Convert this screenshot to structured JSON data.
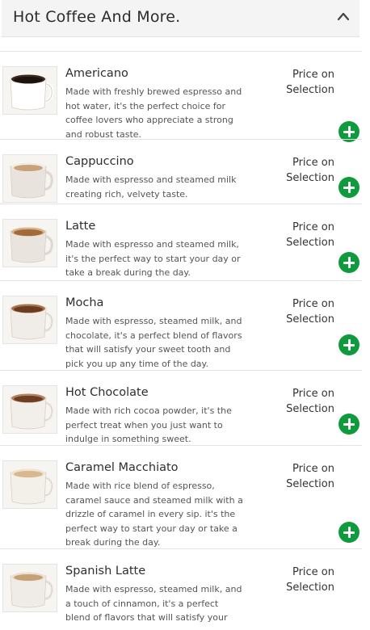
{
  "section": {
    "title": "Hot Coffee And More.",
    "collapse_icon": "chevron-up-icon"
  },
  "items": [
    {
      "name": "Americano",
      "lines": [
        "Made with freshly brewed espresso and",
        "hot water, it's the perfect choice for",
        "coffee lovers who appreciate a strong",
        "and robust taste."
      ],
      "price_line1": "Price on",
      "price_line2": "Selection",
      "image": "americano-image",
      "cup": "#1d120c",
      "rim": "#3a2a20",
      "mug": "#ffffff"
    },
    {
      "name": "Cappuccino",
      "lines": [
        "Made with espresso and steamed milk",
        "creating rich, velvety taste."
      ],
      "price_line1": "Price on",
      "price_line2": "Selection",
      "image": "cappuccino-image",
      "cup": "#c9a27a",
      "rim": "#f1ebe3",
      "mug": "#e8e3dc"
    },
    {
      "name": "Latte",
      "lines": [
        "Made with espresso and steamed milk,",
        "it's the perfect way to start your day or",
        "take a break during the day."
      ],
      "price_line1": "Price on",
      "price_line2": "Selection",
      "image": "latte-image",
      "cup": "#a06a3b",
      "rim": "#d7b48d",
      "mug": "#e9e4de"
    },
    {
      "name": "Mocha",
      "lines": [
        "Made with espresso, steamed milk, and",
        "chocolate, it's a perfect blend of flavors",
        "that will satisfy your sweet tooth and",
        "pick you up any time of the day."
      ],
      "price_line1": "Price on",
      "price_line2": "Selection",
      "image": "mocha-image",
      "cup": "#6b3c22",
      "rim": "#a8744b",
      "mug": "#f0ece7"
    },
    {
      "name": "Hot Chocolate",
      "lines": [
        "Made with rich cocoa powder, it's the",
        "perfect treat when you just want to",
        "indulge in something sweet."
      ],
      "price_line1": "Price on",
      "price_line2": "Selection",
      "image": "hot-chocolate-image",
      "cup": "#6e3d24",
      "rim": "#b48460",
      "mug": "#f2eee9"
    },
    {
      "name": "Caramel Macchiato",
      "lines": [
        "Made with rice blend of espresso,",
        "caramel sauce and steamed milk with a",
        "drizzle of caramel in every sip. it's the",
        "perfect way to start your day or take a",
        "break during the day."
      ],
      "price_line1": "Price on",
      "price_line2": "Selection",
      "image": "caramel-macchiato-image",
      "cup": "#d8b98f",
      "rim": "#efe2cf",
      "mug": "#f3efe9"
    },
    {
      "name": "Spanish Latte",
      "lines": [
        "Made with espresso, steamed milk, and",
        "a touch of cinnamon, it's a perfect",
        "blend of flavors that will satisfy your"
      ],
      "price_line1": "Price on",
      "price_line2": "Selection",
      "image": "spanish-latte-image",
      "cup": "#c8a077",
      "rim": "#ece0d0",
      "mug": "#efebe6"
    }
  ],
  "colors": {
    "accent": "#0e9a3d",
    "header_bg": "#f4f4f4",
    "divider": "#e3e3e3"
  }
}
